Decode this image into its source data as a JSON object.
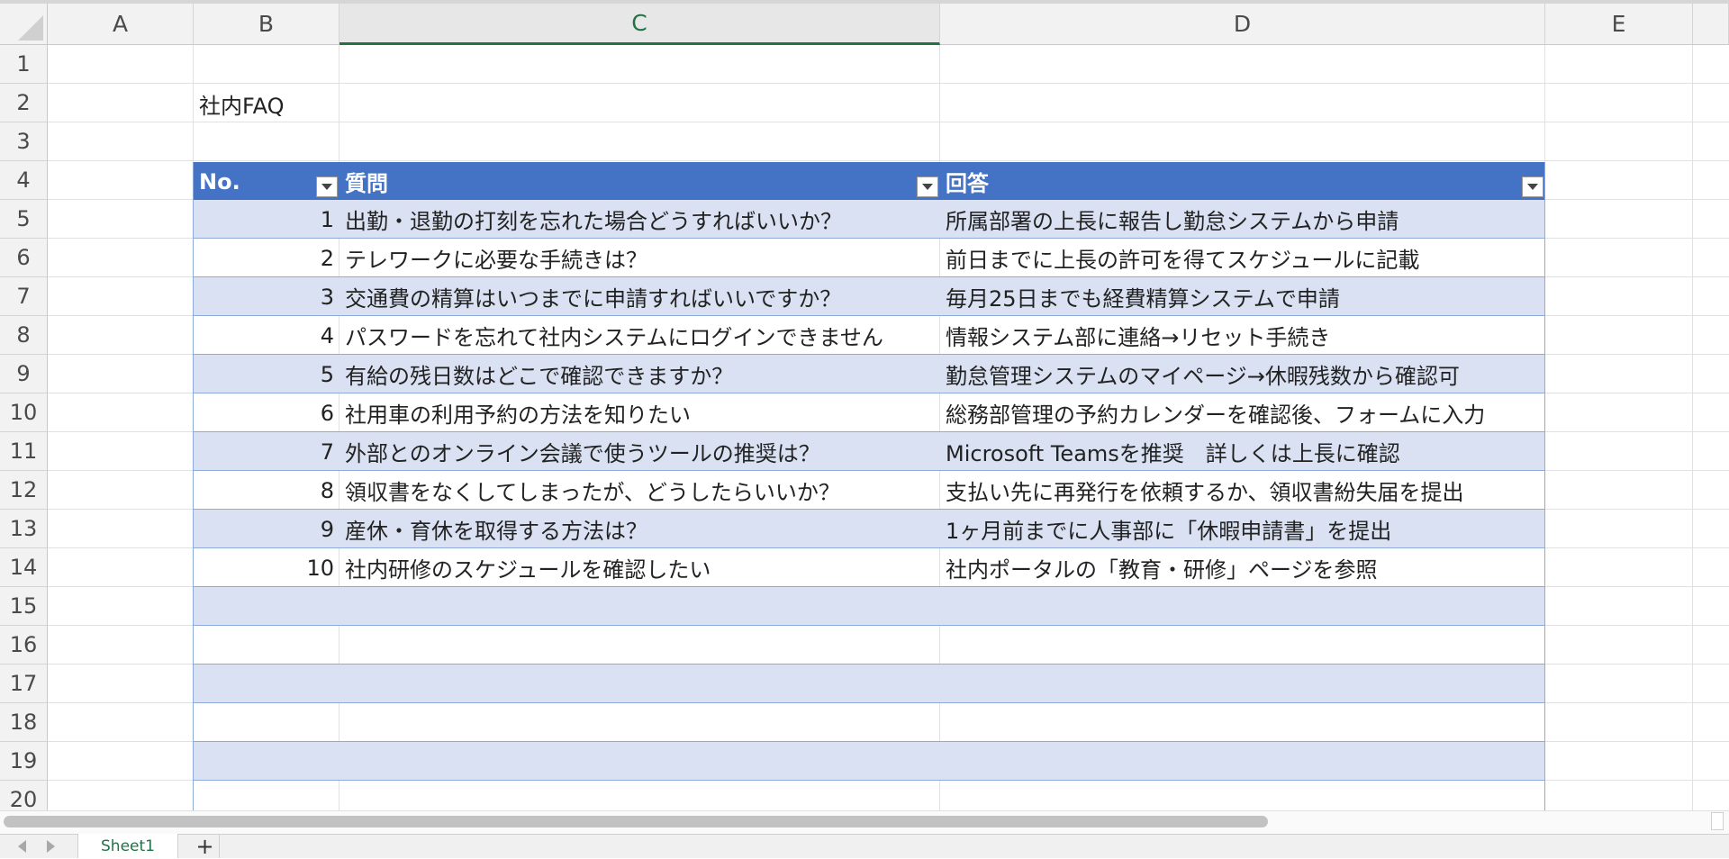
{
  "columns": [
    "A",
    "B",
    "C",
    "D",
    "E"
  ],
  "rows": [
    "1",
    "2",
    "3",
    "4",
    "5",
    "6",
    "7",
    "8",
    "9",
    "10",
    "11",
    "12",
    "13",
    "14",
    "15",
    "16",
    "17",
    "18",
    "19",
    "20"
  ],
  "title": "社内FAQ",
  "table": {
    "headers": {
      "no": "No.",
      "question": "質問",
      "answer": "回答"
    },
    "rows": [
      {
        "no": "1",
        "question": "出勤・退勤の打刻を忘れた場合どうすればいいか？",
        "answer": "所属部署の上長に報告し勤怠システムから申請"
      },
      {
        "no": "2",
        "question": "テレワークに必要な手続きは？",
        "answer": "前日までに上長の許可を得てスケジュールに記載"
      },
      {
        "no": "3",
        "question": "交通費の精算はいつまでに申請すればいいですか？",
        "answer": "毎月25日までも経費精算システムで申請"
      },
      {
        "no": "4",
        "question": "パスワードを忘れて社内システムにログインできません",
        "answer": "情報システム部に連絡→リセット手続き"
      },
      {
        "no": "5",
        "question": "有給の残日数はどこで確認できますか？",
        "answer": "勤怠管理システムのマイページ→休暇残数から確認可"
      },
      {
        "no": "6",
        "question": "社用車の利用予約の方法を知りたい",
        "answer": "総務部管理の予約カレンダーを確認後、フォームに入力"
      },
      {
        "no": "7",
        "question": "外部とのオンライン会議で使うツールの推奨は？",
        "answer": "Microsoft Teamsを推奨　詳しくは上長に確認"
      },
      {
        "no": "8",
        "question": "領収書をなくしてしまったが、どうしたらいいか？",
        "answer": "支払い先に再発行を依頼するか、領収書紛失届を提出"
      },
      {
        "no": "9",
        "question": "産休・育休を取得する方法は？",
        "answer": "1ヶ月前までに人事部に「休暇申請書」を提出"
      },
      {
        "no": "10",
        "question": "社内研修のスケジュールを確認したい",
        "answer": "社内ポータルの「教育・研修」ページを参照"
      }
    ]
  },
  "sheet_tabs": [
    "Sheet1"
  ],
  "add_sheet": "+",
  "colors": {
    "header_fill": "#4472c4",
    "band_fill": "#d9e1f2",
    "accent": "#217346"
  }
}
